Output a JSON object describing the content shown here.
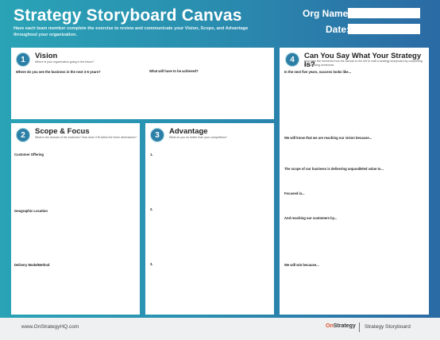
{
  "header": {
    "title": "Strategy Storyboard Canvas",
    "subtitle": "Have each team member complete the exercise to review and communicate your Vision, Scope, and Advantage throughout your organization.",
    "org_label": "Org Name:",
    "date_label": "Date:"
  },
  "vision": {
    "number": "1",
    "title": "Vision",
    "subtitle": "Where is your organization going in the future?",
    "q1": "Where do you see the business in the next 3-5 years?",
    "q2": "What will have to be achieved?"
  },
  "scope": {
    "number": "2",
    "title": "Scope & Focus",
    "subtitle": "What is the domain of the business? How does it fit within the three dimensions?",
    "q1": "Customer Offering",
    "q2": "Geographic Location",
    "q3": "Delivery Mode/Method"
  },
  "advantage": {
    "number": "3",
    "title": "Advantage",
    "subtitle": "What do you do better than your competitors?",
    "items": [
      "1.",
      "2.",
      "3."
    ]
  },
  "say": {
    "number": "4",
    "title": "Can You Say What Your Strategy Is?",
    "subtitle": "Now take the elements from the canvas to the left to craft a strategy storyboard by completing the following sentences.",
    "prompts": [
      "In the next five years, success looks like...",
      "We will know that we are reaching our vision because...",
      "The scope of our business is delivering unparalleled value to...",
      "Focused in...",
      "And reaching our customers by...",
      "We will win because..."
    ]
  },
  "footer": {
    "url": "www.OnStrategyHQ.com",
    "brand_on": "On",
    "brand_rest": "Strategy",
    "doc_name": "Strategy Storyboard"
  }
}
